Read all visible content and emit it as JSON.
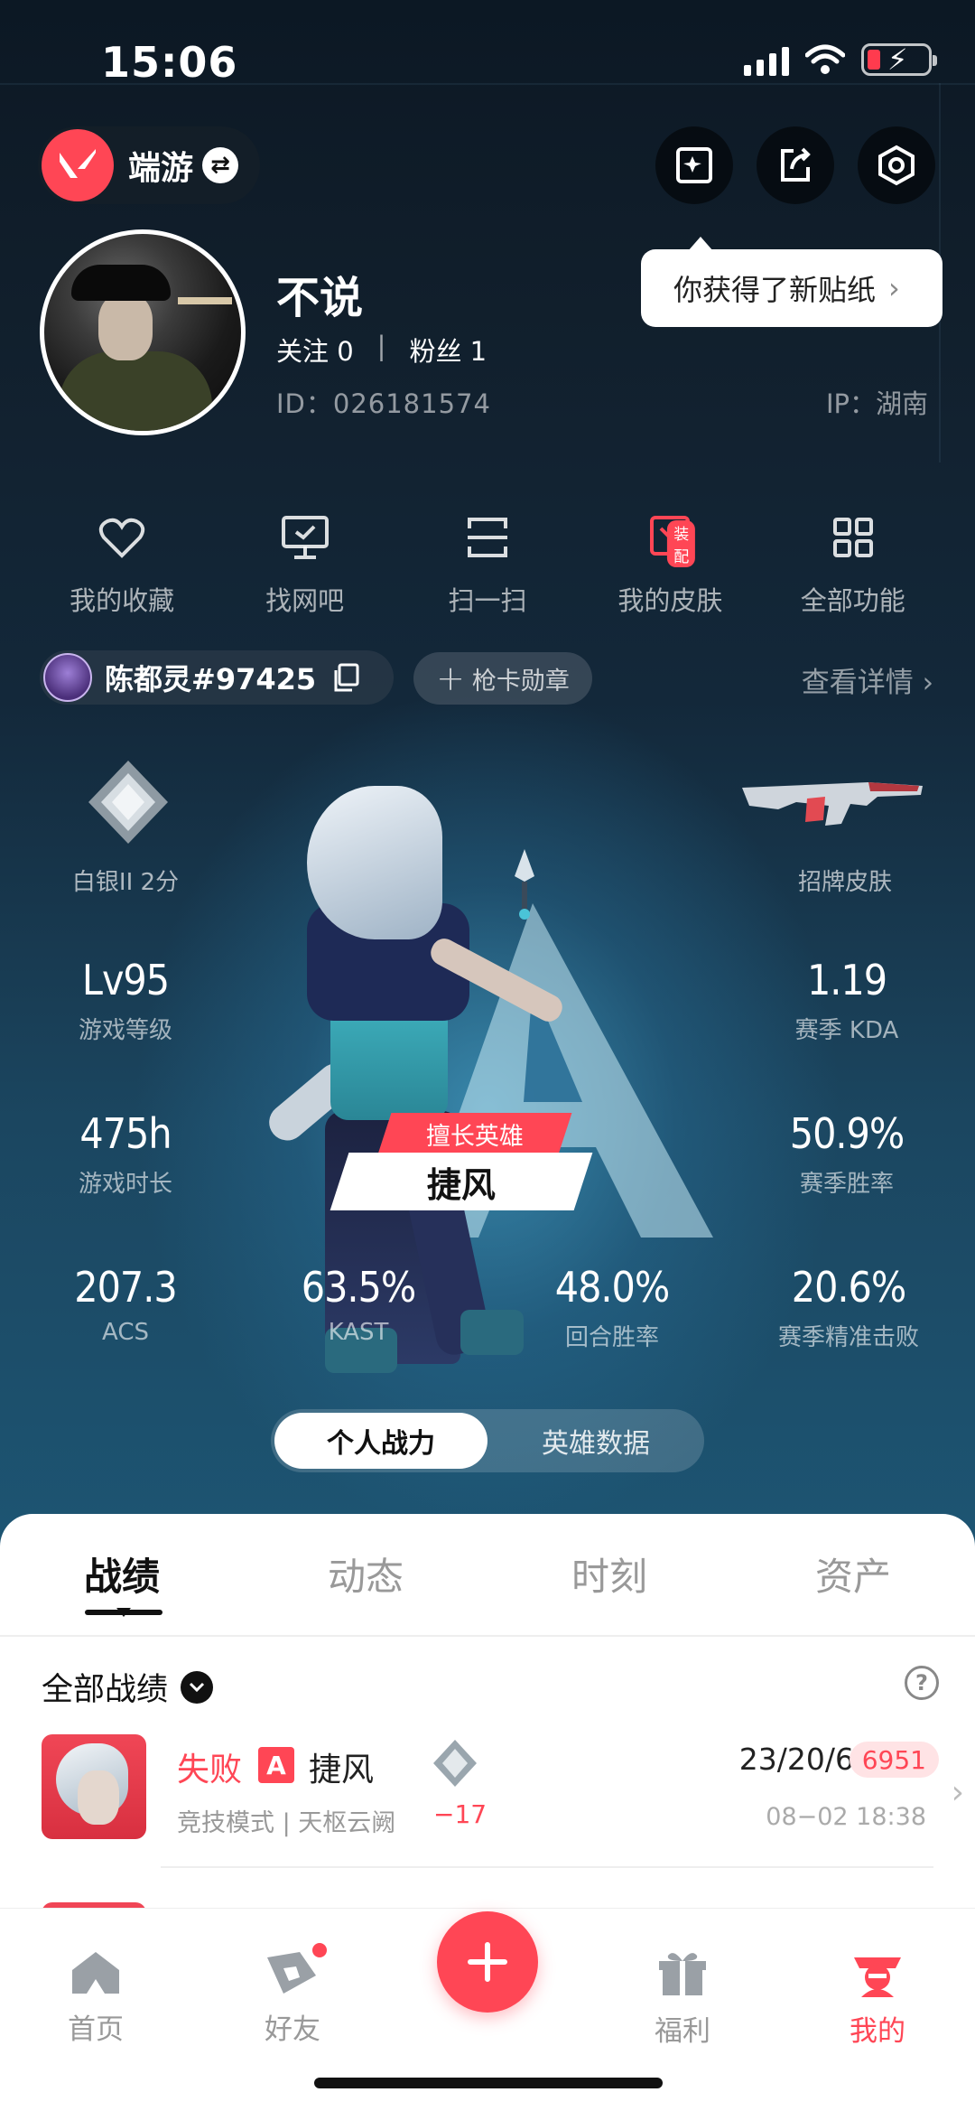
{
  "status": {
    "time": "15:06"
  },
  "header": {
    "app_name": "端游",
    "tooltip": "你获得了新贴纸"
  },
  "profile": {
    "nickname": "不说",
    "follow_label": "关注 0",
    "fans_label": "粉丝 1",
    "separator": "|",
    "id": "ID：026181574",
    "ip": "IP：湖南"
  },
  "quick_menu": [
    {
      "label": "我的收藏",
      "icon": "heart-icon"
    },
    {
      "label": "找网吧",
      "icon": "monitor-icon"
    },
    {
      "label": "扫一扫",
      "icon": "scan-icon"
    },
    {
      "label": "我的皮肤",
      "icon": "skin-icon",
      "badge": "装配"
    },
    {
      "label": "全部功能",
      "icon": "grid-icon"
    }
  ],
  "game_account": {
    "name": "陈都灵#97425",
    "badge_button": "枪卡勋章",
    "detail_link": "查看详情"
  },
  "stats": {
    "rank_label": "白银II 2分",
    "skin_label": "招牌皮肤",
    "level": {
      "value": "Lv95",
      "label": "游戏等级"
    },
    "kda": {
      "value": "1.19",
      "label": "赛季 KDA"
    },
    "hours": {
      "value": "475h",
      "label": "游戏时长"
    },
    "winrate": {
      "value": "50.9%",
      "label": "赛季胜率"
    },
    "acs": {
      "value": "207.3",
      "label": "ACS"
    },
    "kast": {
      "value": "63.5%",
      "label": "KAST"
    },
    "round_win": {
      "value": "48.0%",
      "label": "回合胜率"
    },
    "first_kill": {
      "value": "20.6%",
      "label": "赛季精准击败"
    },
    "main_hero_tag": "擅长英雄",
    "main_hero_name": "捷风"
  },
  "segment": {
    "active": "个人战力",
    "inactive": "英雄数据"
  },
  "tabs": [
    "战绩",
    "动态",
    "时刻",
    "资产"
  ],
  "records": {
    "filter": "全部战绩",
    "matches": [
      {
        "result": "失败",
        "mode_tag": "A",
        "agent": "捷风",
        "mode": "竞技模式 | 天枢云阙",
        "delta": "−17",
        "kda": "23/20/6",
        "score": "6951",
        "time": "08−02 18:38"
      }
    ]
  },
  "bottom_nav": [
    {
      "label": "首页"
    },
    {
      "label": "好友"
    },
    {
      "label": "福利"
    },
    {
      "label": "我的"
    }
  ],
  "colors": {
    "accent": "#ff4655",
    "bg_dark": "#0e1a26"
  }
}
